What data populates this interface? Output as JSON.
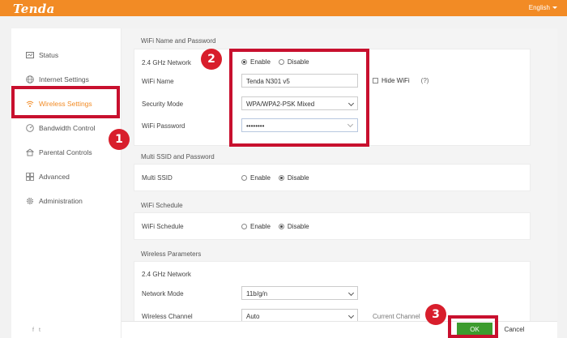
{
  "header": {
    "logo": "Tenda",
    "language": "English"
  },
  "sidebar": {
    "items": [
      {
        "label": "Status",
        "icon": "status-icon"
      },
      {
        "label": "Internet Settings",
        "icon": "globe-icon"
      },
      {
        "label": "Wireless Settings",
        "icon": "wifi-icon",
        "active": true
      },
      {
        "label": "Bandwidth Control",
        "icon": "bandwidth-icon"
      },
      {
        "label": "Parental Controls",
        "icon": "parental-icon"
      },
      {
        "label": "Advanced",
        "icon": "advanced-icon"
      },
      {
        "label": "Administration",
        "icon": "gear-icon"
      }
    ],
    "social": [
      "f",
      "t"
    ]
  },
  "wifi_name_password": {
    "title": "WiFi Name and Password",
    "network_label": "2.4 GHz Network",
    "enable_label": "Enable",
    "disable_label": "Disable",
    "enabled": true,
    "wifi_name_label": "WiFi Name",
    "wifi_name_value": "Tenda N301 v5",
    "hide_wifi_label": "Hide WiFi",
    "help_label": "(?)",
    "security_mode_label": "Security Mode",
    "security_mode_value": "WPA/WPA2-PSK Mixed",
    "password_label": "WiFi Password",
    "password_value": "••••••••"
  },
  "multi_ssid": {
    "title": "Multi SSID and Password",
    "label": "Multi SSID",
    "enable_label": "Enable",
    "disable_label": "Disable",
    "enabled": false
  },
  "wifi_schedule": {
    "title": "WiFi Schedule",
    "label": "WiFi Schedule",
    "enable_label": "Enable",
    "disable_label": "Disable",
    "enabled": false
  },
  "wireless_params": {
    "title": "Wireless Parameters",
    "subtitle": "2.4 GHz Network",
    "network_mode_label": "Network Mode",
    "network_mode_value": "11b/g/n",
    "channel_label": "Wireless Channel",
    "channel_value": "Auto",
    "current_channel_label": "Current Channel"
  },
  "footer": {
    "ok_label": "OK",
    "cancel_label": "Cancel"
  },
  "annotations": {
    "badge_1": "1",
    "badge_2": "2",
    "badge_3": "3",
    "color": "#c8102e"
  }
}
